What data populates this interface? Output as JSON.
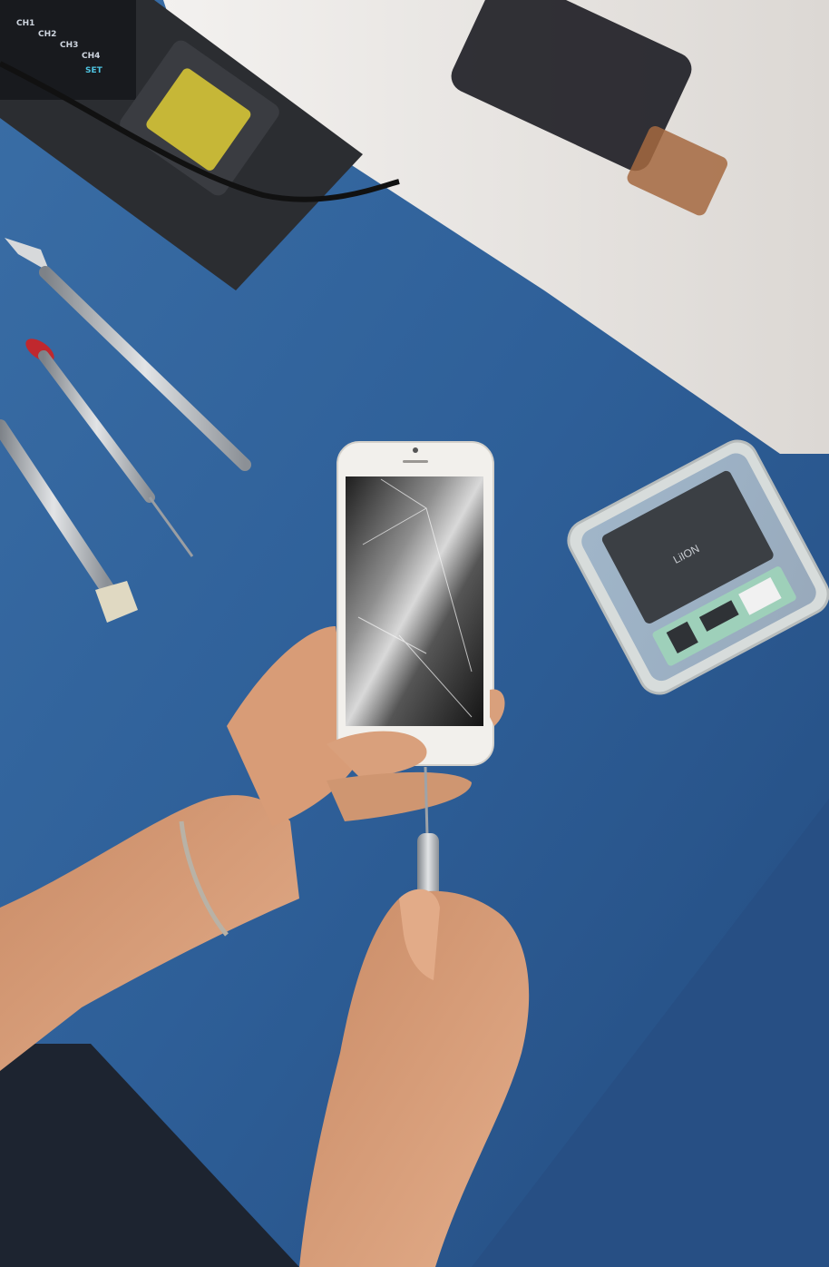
{
  "scene": {
    "description_colors": {
      "table": "#2f5f96",
      "table_dark": "#1f4273",
      "metal": "#b9bcc0",
      "skin": "#d9a07c",
      "phone_white": "#f2f0ec",
      "screen": "#2a2a2a",
      "circuit_green": "#9fd6b8"
    }
  },
  "soldering_station": {
    "channel_labels": [
      "CH1",
      "CH2",
      "CH3",
      "CH4",
      "SET"
    ]
  },
  "battery": {
    "label_text": "LiION"
  }
}
